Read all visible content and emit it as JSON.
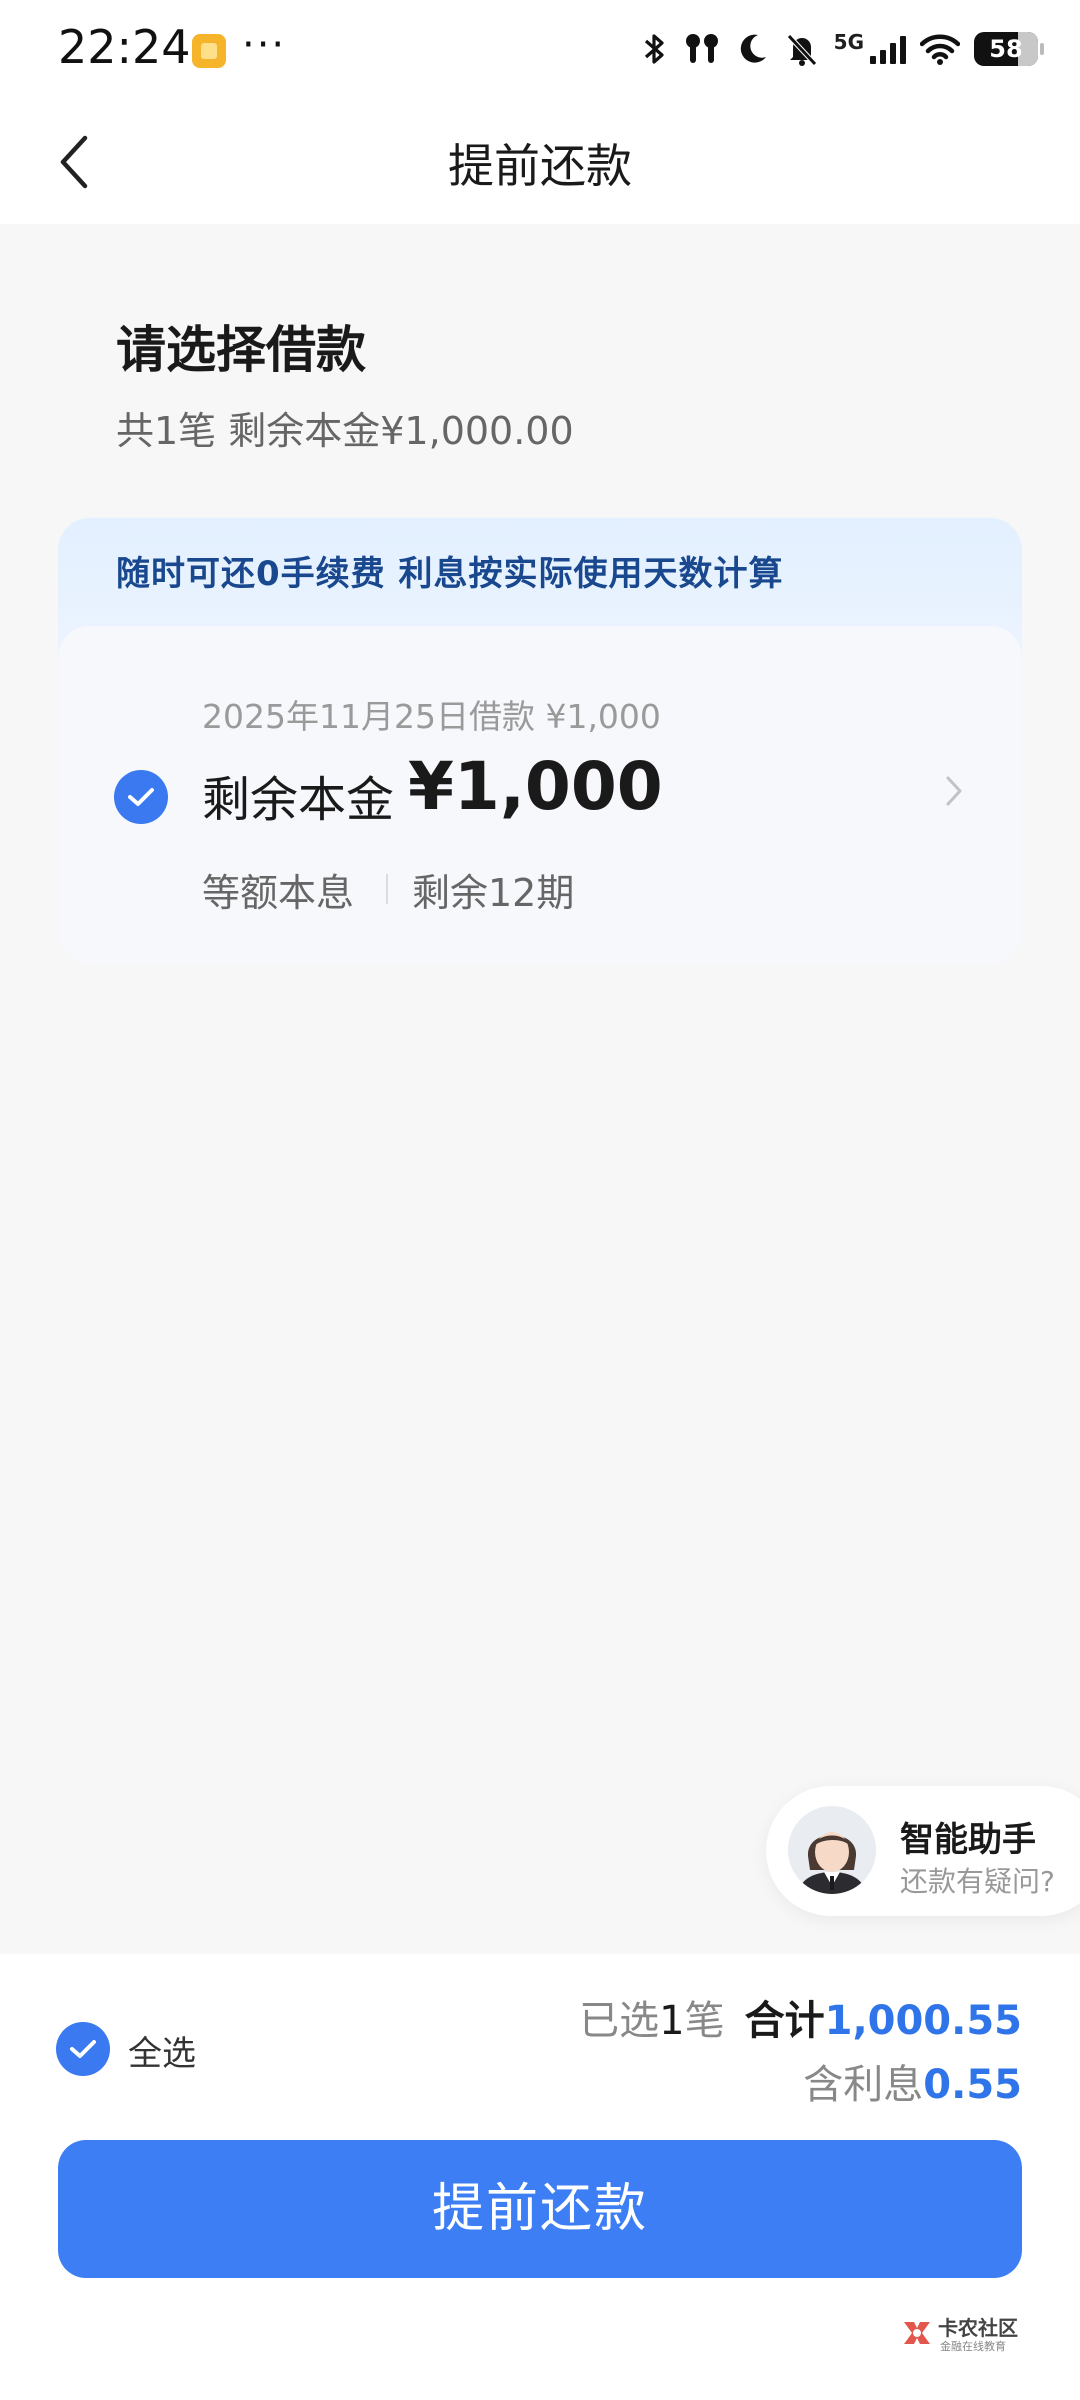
{
  "status_bar": {
    "time": "22:24",
    "more_indicator": "···",
    "network": "5G",
    "battery": "58",
    "icons": [
      "bluetooth-icon",
      "earbuds-icon",
      "moon-icon",
      "mute-icon",
      "signal-icon",
      "wifi-icon",
      "battery-icon"
    ]
  },
  "nav": {
    "title": "提前还款",
    "back_icon": "chevron-left-icon"
  },
  "section": {
    "title": "请选择借款",
    "subtitle": "共1笔 剩余本金¥1,000.00"
  },
  "banner": {
    "text": "随时可还0手续费 利息按实际使用天数计算"
  },
  "loans": [
    {
      "checked": true,
      "date_amount": "2025年11月25日借款 ¥1,000",
      "principal_label": "剩余本金",
      "principal": "¥1,000",
      "repay_type": "等额本息",
      "periods": "剩余12期"
    }
  ],
  "assistant": {
    "title": "智能助手",
    "subtitle": "还款有疑问?"
  },
  "footer": {
    "select_all_label": "全选",
    "select_all_checked": true,
    "selected_prefix": "已选",
    "selected_count": "1",
    "selected_suffix": "笔",
    "total_label": "合计",
    "total_value": "1,000.55",
    "interest_label": "含利息",
    "interest_value": "0.55",
    "button_label": "提前还款"
  },
  "watermark": {
    "name": "卡农社区",
    "sub": "金融在线教育"
  },
  "colors": {
    "accent": "#3d7ef4",
    "banner_text": "#19488f",
    "background": "#f7f7f7"
  }
}
